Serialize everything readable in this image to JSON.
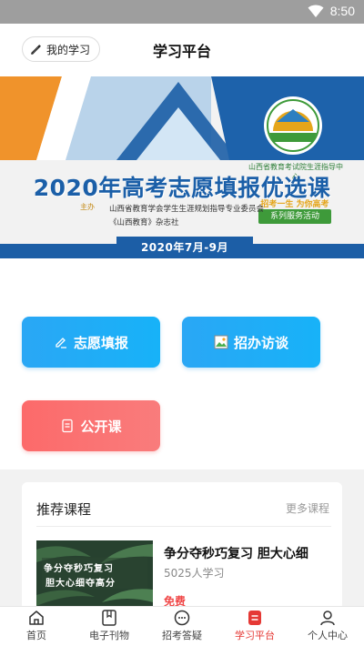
{
  "status_bar": {
    "time": "8:50"
  },
  "header": {
    "my_study_label": "我的学习",
    "title": "学习平台"
  },
  "banner": {
    "title": "2020年高考志愿填报优选课",
    "sponsor_label": "主办",
    "organizers": [
      "山西省教育学会学生生涯规划指导专业委员会",
      "《山西教育》杂志社"
    ],
    "date_range": "2020年7月-9月",
    "logo_slogan": "招考一生 为你高考",
    "logo_label": "系列服务活动",
    "logo_arc_text": "山西省教育考试院生涯指导中心",
    "colors": {
      "primary": "#1c5ea6",
      "accent": "#f0932b"
    }
  },
  "actions": {
    "volunteer_fill": "志愿填报",
    "admission_interview": "招办访谈",
    "open_course": "公开课"
  },
  "recommend": {
    "title": "推荐课程",
    "more": "更多课程",
    "course": {
      "thumb_line1": "争分夺秒巧复习",
      "thumb_line2": "胆大心细夺高分",
      "title": "争分夺秒巧复习 胆大心细",
      "learners": "5025人学习",
      "price": "免费"
    }
  },
  "bottom_nav": {
    "items": [
      {
        "label": "首页",
        "icon": "home-icon"
      },
      {
        "label": "电子刊物",
        "icon": "magazine-icon"
      },
      {
        "label": "招考答疑",
        "icon": "chat-icon"
      },
      {
        "label": "学习平台",
        "icon": "study-icon",
        "active": true
      },
      {
        "label": "个人中心",
        "icon": "user-icon"
      }
    ],
    "colors": {
      "active": "#e53935",
      "inactive": "#444444"
    }
  }
}
